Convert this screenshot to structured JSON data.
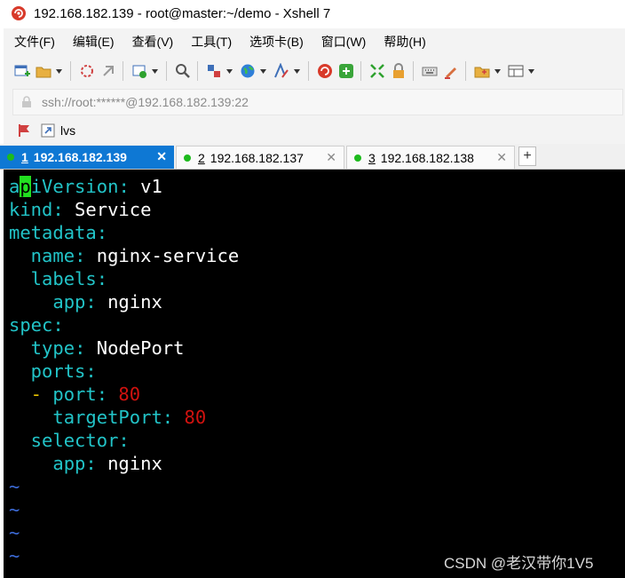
{
  "window": {
    "title": "192.168.182.139 - root@master:~/demo - Xshell 7",
    "app_icon": "xshell-logo-icon"
  },
  "menubar": {
    "items": [
      "文件(F)",
      "编辑(E)",
      "查看(V)",
      "工具(T)",
      "选项卡(B)",
      "窗口(W)",
      "帮助(H)"
    ]
  },
  "toolbar": {
    "icons": [
      "new-session-icon",
      "open-folder-icon",
      "disconnect-icon",
      "reconnect-icon",
      "new-tab-icon",
      "find-icon",
      "transfer-icon",
      "globe-icon",
      "font-icon",
      "xshell-icon",
      "xftp-icon",
      "fullscreen-icon",
      "lock-icon",
      "keyboard-icon",
      "highlight-icon",
      "new-folder-icon",
      "layout-icon"
    ]
  },
  "addressbar": {
    "icon": "lock-icon",
    "address": "ssh://root:******@192.168.182.139:22"
  },
  "links": {
    "label": "lvs"
  },
  "tabs": [
    {
      "num": "1",
      "ip": "192.168.182.139",
      "active": true
    },
    {
      "num": "2",
      "ip": "192.168.182.137",
      "active": false
    },
    {
      "num": "3",
      "ip": "192.168.182.138",
      "active": false
    }
  ],
  "tab_add": "+",
  "terminal": {
    "line1": {
      "cursor_pre": "a",
      "cursor": "p",
      "rest": "iVersion",
      "colon": ":",
      "val": " v1"
    },
    "line2": {
      "key": "kind",
      "colon": ":",
      "val": " Service"
    },
    "line3": {
      "key": "metadata",
      "colon": ":"
    },
    "line4": {
      "key": "  name",
      "colon": ":",
      "val": " nginx-service"
    },
    "line5": {
      "key": "  labels",
      "colon": ":"
    },
    "line6": {
      "key": "    app",
      "colon": ":",
      "val": " nginx"
    },
    "line7": {
      "key": "spec",
      "colon": ":"
    },
    "line8": {
      "key": "  type",
      "colon": ":",
      "val": " NodePort"
    },
    "line9": {
      "key": "  ports",
      "colon": ":"
    },
    "line10": {
      "dash": "  - ",
      "key": "port",
      "colon": ":",
      "num": " 80"
    },
    "line11": {
      "key": "    targetPort",
      "colon": ":",
      "num": " 80"
    },
    "line12": {
      "key": "  selector",
      "colon": ":"
    },
    "line13": {
      "key": "    app",
      "colon": ":",
      "val": " nginx"
    },
    "tilde": "~"
  },
  "watermark": "CSDN @老汉带你1V5",
  "colors": {
    "active_tab": "#0e78d4",
    "yaml_key": "#22c4c8",
    "yaml_number": "#d0120f",
    "cursor": "#22e020",
    "tilde": "#3d6cd9",
    "status_dot": "#1dbb1d"
  }
}
